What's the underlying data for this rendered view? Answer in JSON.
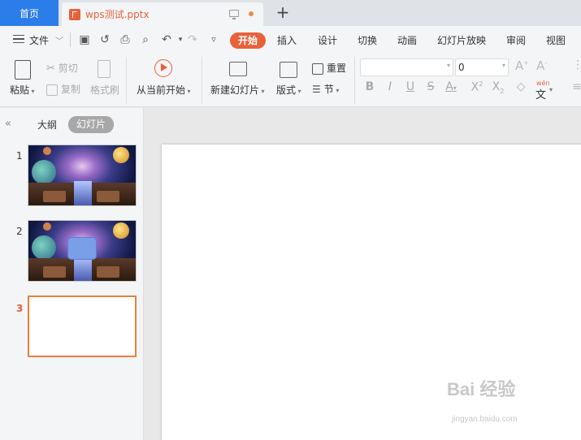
{
  "titlebar": {
    "home_tab": "首页",
    "doc_tab": "wps测试.pptx",
    "new_tab": "+"
  },
  "menubar": {
    "file_label": "文件",
    "tabs": [
      {
        "label": "开始",
        "active": true
      },
      {
        "label": "插入"
      },
      {
        "label": "设计"
      },
      {
        "label": "切换"
      },
      {
        "label": "动画"
      },
      {
        "label": "幻灯片放映"
      },
      {
        "label": "审阅"
      },
      {
        "label": "视图"
      }
    ]
  },
  "ribbon": {
    "paste": "粘贴",
    "cut": "剪切",
    "copy": "复制",
    "format_painter": "格式刷",
    "play_from_current": "从当前开始",
    "new_slide": "新建幻灯片",
    "layout": "版式",
    "reset": "重置",
    "section": "节",
    "font_size_value": "0",
    "wen_label": "wén",
    "wen_char": "文"
  },
  "leftpanel": {
    "view_outline": "大纲",
    "view_slides": "幻灯片",
    "slides": [
      {
        "number": "1"
      },
      {
        "number": "2"
      },
      {
        "number": "3",
        "active": true
      }
    ]
  },
  "watermark": {
    "main": "Bai 经验",
    "sub": "jingyan.baidu.com"
  },
  "colors": {
    "accent": "#e8613a",
    "home_tab": "#2b7de9",
    "panel_bg": "#f4f5f7"
  }
}
